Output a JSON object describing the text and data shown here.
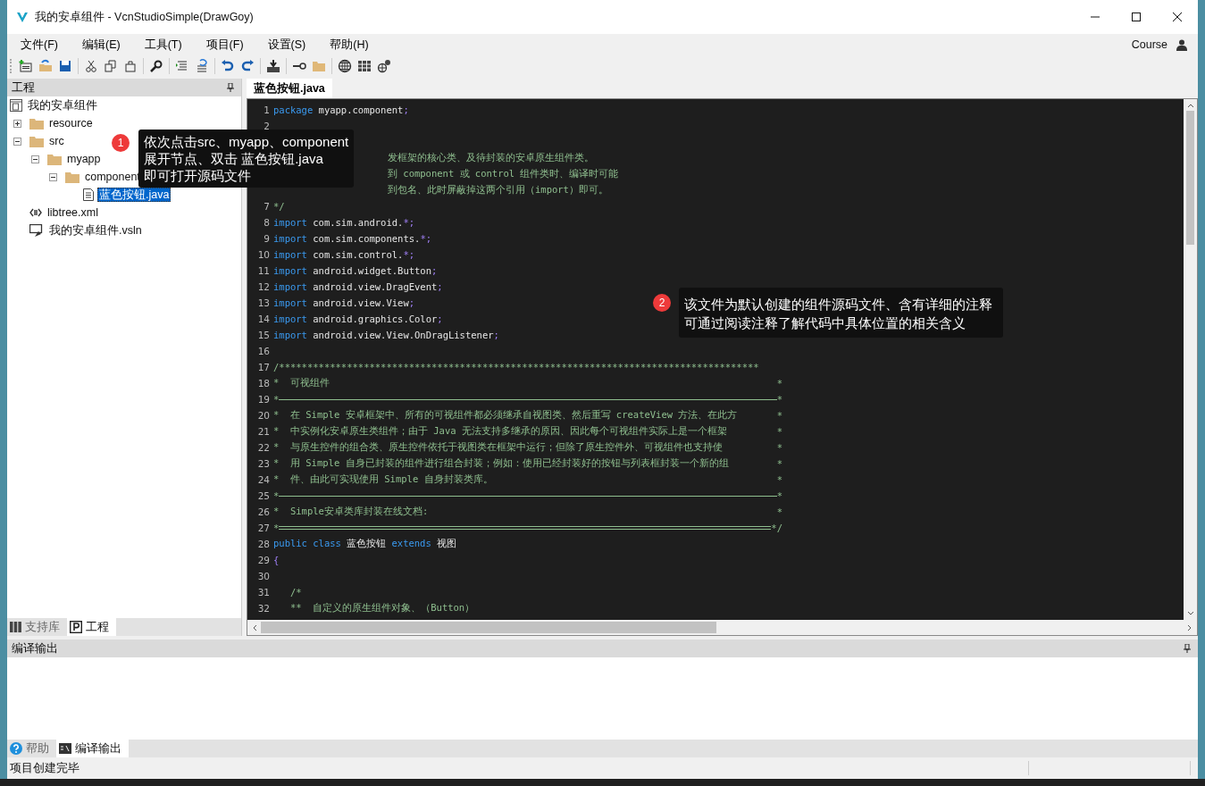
{
  "window": {
    "title": "我的安卓组件 - VcnStudioSimple(DrawGoy)",
    "user": "Course"
  },
  "menu": [
    "文件(F)",
    "编辑(E)",
    "工具(T)",
    "项目(F)",
    "设置(S)",
    "帮助(H)"
  ],
  "project_panel": {
    "title": "工程",
    "items": [
      {
        "label": "我的安卓组件",
        "kind": "project",
        "selected": false,
        "children": [
          {
            "label": "resource",
            "kind": "folder",
            "expanded": false,
            "selected": false
          },
          {
            "label": "src",
            "kind": "folder",
            "expanded": true,
            "selected": false,
            "children": [
              {
                "label": "myapp",
                "kind": "folder",
                "expanded": true,
                "selected": false,
                "children": [
                  {
                    "label": "component",
                    "kind": "folder",
                    "expanded": true,
                    "selected": false,
                    "children": [
                      {
                        "label": "蓝色按钮.java",
                        "kind": "file",
                        "selected": true
                      }
                    ]
                  }
                ]
              }
            ]
          },
          {
            "label": "libtree.xml",
            "kind": "xml",
            "selected": false
          },
          {
            "label": "我的安卓组件.vsln",
            "kind": "solution",
            "selected": false
          }
        ]
      }
    ],
    "tabs": [
      {
        "label": "支持库",
        "kind": "library",
        "selected": false
      },
      {
        "label": "工程",
        "kind": "project",
        "selected": true
      }
    ]
  },
  "editor": {
    "tabs": [
      {
        "label": "蓝色按钮.java",
        "selected": true
      }
    ],
    "lines": [
      {
        "no": "1",
        "kind": "code",
        "segments": [
          {
            "kind": "keyword",
            "text": "package"
          },
          {
            "kind": "plain",
            "text": " myapp.component"
          },
          {
            "kind": "op",
            "text": ";"
          }
        ]
      },
      {
        "no": "2",
        "kind": "code"
      },
      {
        "kind": "covered"
      },
      {
        "kind": "covered",
        "text": "发框架的核心类、及待封装的安卓原生组件类。"
      },
      {
        "kind": "covered",
        "text": "到 component 或 control 组件类时、编译时可能"
      },
      {
        "kind": "covered",
        "text": "到包名、此时屏蔽掉这两个引用（import）即可。"
      },
      {
        "no": "7",
        "kind": "code",
        "segments": [
          {
            "kind": "comment",
            "text": "*/"
          }
        ]
      },
      {
        "no": "8",
        "kind": "code",
        "segments": [
          {
            "kind": "keyword",
            "text": "import"
          },
          {
            "kind": "plain",
            "text": " com.sim.android."
          },
          {
            "kind": "op",
            "text": "*;"
          }
        ]
      },
      {
        "no": "9",
        "kind": "code",
        "segments": [
          {
            "kind": "keyword",
            "text": "import"
          },
          {
            "kind": "plain",
            "text": " com.sim.components."
          },
          {
            "kind": "op",
            "text": "*;"
          }
        ]
      },
      {
        "no": "10",
        "kind": "code",
        "segments": [
          {
            "kind": "keyword",
            "text": "import"
          },
          {
            "kind": "plain",
            "text": " com.sim.control."
          },
          {
            "kind": "op",
            "text": "*;"
          }
        ]
      },
      {
        "no": "11",
        "kind": "code",
        "segments": [
          {
            "kind": "keyword",
            "text": "import"
          },
          {
            "kind": "plain",
            "text": " android.widget.Button"
          },
          {
            "kind": "op",
            "text": ";"
          }
        ]
      },
      {
        "no": "12",
        "kind": "code",
        "segments": [
          {
            "kind": "keyword",
            "text": "import"
          },
          {
            "kind": "plain",
            "text": " android.view.DragEvent"
          },
          {
            "kind": "op",
            "text": ";"
          }
        ]
      },
      {
        "no": "13",
        "kind": "code",
        "segments": [
          {
            "kind": "keyword",
            "text": "import"
          },
          {
            "kind": "plain",
            "text": " android.view.View"
          },
          {
            "kind": "op",
            "text": ";"
          }
        ]
      },
      {
        "no": "14",
        "kind": "code",
        "segments": [
          {
            "kind": "keyword",
            "text": "import"
          },
          {
            "kind": "plain",
            "text": " android.graphics.Color"
          },
          {
            "kind": "op",
            "text": ";"
          }
        ]
      },
      {
        "no": "15",
        "kind": "code",
        "segments": [
          {
            "kind": "keyword",
            "text": "import"
          },
          {
            "kind": "plain",
            "text": " android.view.View.OnDragListener"
          },
          {
            "kind": "op",
            "text": ";"
          }
        ]
      },
      {
        "no": "16",
        "kind": "code"
      },
      {
        "no": "17",
        "kind": "code",
        "segments": [
          {
            "kind": "comment",
            "text": "/*************************************************************************************"
          }
        ]
      },
      {
        "no": "18",
        "kind": "box",
        "body": "*  可视组件",
        "end": "*"
      },
      {
        "no": "19",
        "kind": "rule",
        "start": "*",
        "end": "*",
        "double": false
      },
      {
        "no": "20",
        "kind": "box",
        "body": "*  在 Simple 安卓框架中、所有的可视组件都必须继承自视图类、然后重写 createView 方法、在此方",
        "end": "*"
      },
      {
        "no": "21",
        "kind": "box",
        "body": "*  中实例化安卓原生类组件；由于 Java 无法支持多继承的原因、因此每个可视组件实际上是一个框架",
        "end": "*"
      },
      {
        "no": "22",
        "kind": "box",
        "body": "*  与原生控件的组合类、原生控件依托于视图类在框架中运行；但除了原生控件外、可视组件也支持使",
        "end": "*"
      },
      {
        "no": "23",
        "kind": "box",
        "body": "*  用 Simple 自身已封装的组件进行组合封装；例如：使用已经封装好的按钮与列表框封装一个新的组",
        "end": "*"
      },
      {
        "no": "24",
        "kind": "box",
        "body": "*  件、由此可实现使用 Simple 自身封装类库。",
        "end": "*"
      },
      {
        "no": "25",
        "kind": "rule",
        "start": "*",
        "end": "*",
        "double": false
      },
      {
        "no": "26",
        "kind": "box",
        "body": "*  Simple安卓类库封装在线文档:",
        "end": "*"
      },
      {
        "no": "27",
        "kind": "rule",
        "start": "*",
        "end": "*/",
        "double": true
      },
      {
        "no": "28",
        "kind": "code",
        "segments": [
          {
            "kind": "keyword",
            "text": "public class"
          },
          {
            "kind": "plain",
            "text": " 蓝色按钮 "
          },
          {
            "kind": "keyword",
            "text": "extends"
          },
          {
            "kind": "plain",
            "text": " 视图"
          }
        ]
      },
      {
        "no": "29",
        "kind": "code",
        "segments": [
          {
            "kind": "op",
            "text": "{"
          }
        ]
      },
      {
        "no": "30",
        "kind": "code"
      },
      {
        "no": "31",
        "kind": "code",
        "segments": [
          {
            "kind": "comment",
            "text": "   /*"
          }
        ]
      },
      {
        "no": "32",
        "kind": "code",
        "segments": [
          {
            "kind": "comment",
            "text": "   **  自定义的原生组件对象、（Button）"
          }
        ]
      }
    ]
  },
  "callouts": [
    {
      "number": "1",
      "lines": [
        "依次点击src、myapp、component",
        "展开节点、双击 蓝色按钮.java",
        "即可打开源码文件"
      ]
    },
    {
      "number": "2",
      "lines": [
        "该文件为默认创建的组件源码文件、含有详细的注释",
        "可通过阅读注释了解代码中具体位置的相关含义"
      ]
    }
  ],
  "output_panel": {
    "title": "编译输出",
    "tabs": [
      {
        "label": "帮助",
        "kind": "help",
        "selected": false
      },
      {
        "label": "编译输出",
        "kind": "console",
        "selected": true
      }
    ]
  },
  "status_bar": {
    "text": "项目创建完毕"
  }
}
